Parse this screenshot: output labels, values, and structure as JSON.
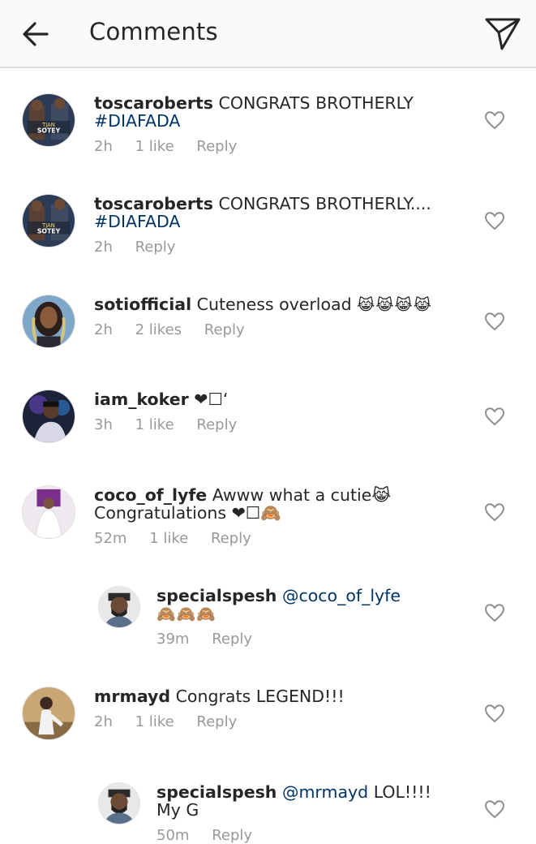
{
  "header": {
    "title": "Comments",
    "back_icon": "arrow-left-icon",
    "send_icon": "paper-plane-icon"
  },
  "comments": [
    {
      "username": "toscaroberts",
      "text": "CONGRATS BROTHERLY",
      "hashtag": "#DIAFADA",
      "time": "2h",
      "likes": "1 like",
      "reply": "Reply",
      "avatar_text_1": "TJAN",
      "avatar_text_2": "SOTEY"
    },
    {
      "username": "toscaroberts",
      "text": "CONGRATS BROTHERLY....",
      "hashtag": "#DIAFADA",
      "time": "2h",
      "reply": "Reply",
      "avatar_text_1": "TJAN",
      "avatar_text_2": "SOTEY"
    },
    {
      "username": "sotiofficial",
      "text": "Cuteness overload",
      "emoji": "😹😹😹😹",
      "time": "2h",
      "likes": "2 likes",
      "reply": "Reply"
    },
    {
      "username": "iam_koker",
      "text": "❤☐‘",
      "time": "3h",
      "likes": "1 like",
      "reply": "Reply"
    },
    {
      "username": "coco_of_lyfe",
      "text": "Awww what a cutie😹",
      "text_line2": "Congratulations ❤☐🙈",
      "time": "52m",
      "likes": "1 like",
      "reply": "Reply"
    },
    {
      "username": "specialspesh",
      "mention": "@coco_of_lyfe",
      "emoji": "🙈🙈🙈",
      "time": "39m",
      "reply": "Reply"
    },
    {
      "username": "mrmayd",
      "text": "Congrats LEGEND!!!",
      "time": "2h",
      "likes": "1 like",
      "reply": "Reply"
    },
    {
      "username": "specialspesh",
      "mention": "@mrmayd",
      "text": "LOL!!!!",
      "text_line2": "My G",
      "time": "50m",
      "reply": "Reply"
    }
  ],
  "colors": {
    "text": "#262626",
    "muted": "#999999",
    "link": "#003569",
    "header_bg": "#fafafa",
    "divider": "#dbdbdb"
  }
}
